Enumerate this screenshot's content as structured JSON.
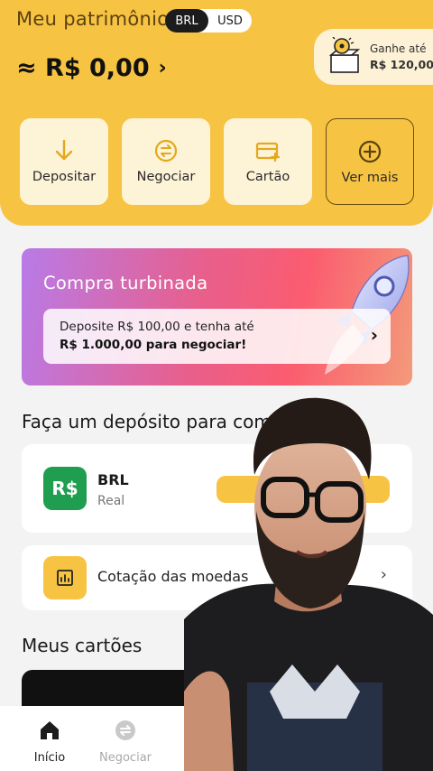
{
  "header": {
    "title": "Meu patrimônio",
    "currencies": [
      "BRL",
      "USD"
    ],
    "balance": "≈ R$ 0,00",
    "balance_chevron": "›",
    "promo_line1": "Ganhe até",
    "promo_line2": "R$ 120,00"
  },
  "actions": [
    {
      "label": "Depositar",
      "icon": "arrow-down-icon"
    },
    {
      "label": "Negociar",
      "icon": "exchange-icon"
    },
    {
      "label": "Cartão",
      "icon": "card-icon"
    },
    {
      "label": "Ver mais",
      "icon": "plus-circle-icon"
    }
  ],
  "turbo": {
    "title": "Compra turbinada",
    "line1": "Deposite R$ 100,00 e tenha até",
    "line2": "R$ 1.000,00 para negociar!",
    "chevron": "›"
  },
  "deposit_section": {
    "title": "Faça um depósito para com"
  },
  "currency_card": {
    "logo_text": "R$",
    "code": "BRL",
    "name": "Real"
  },
  "fx_card": {
    "label": "Cotação das moedas",
    "chevron": "›"
  },
  "cards_section": {
    "title": "Meus cartões"
  },
  "bottom_nav": [
    {
      "label": "Início",
      "icon": "home-icon",
      "active": true
    },
    {
      "label": "Negociar",
      "icon": "exchange-icon",
      "active": false
    }
  ],
  "colors": {
    "brand_yellow": "#f7c342",
    "dark": "#1c1c1c",
    "green": "#1f9e4f"
  }
}
